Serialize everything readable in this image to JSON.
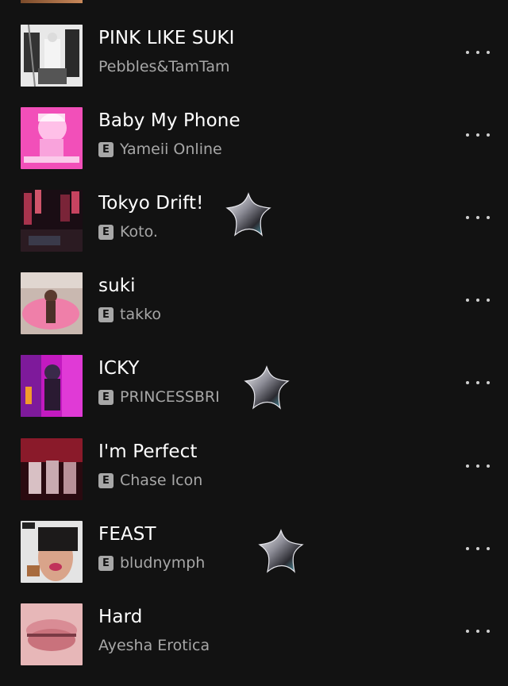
{
  "tracks": [
    {
      "title": "PINK LIKE SUKI",
      "artist": "Pebbles&TamTam",
      "explicit": false,
      "explicit_badge": "",
      "cover": "cover-art-pink-like-suki"
    },
    {
      "title": "Baby My Phone",
      "artist": "Yameii Online",
      "explicit": true,
      "explicit_badge": "E",
      "cover": "cover-art-baby-my-phone"
    },
    {
      "title": "Tokyo Drift!",
      "artist": "Koto.",
      "explicit": true,
      "explicit_badge": "E",
      "cover": "cover-art-tokyo-drift"
    },
    {
      "title": "suki",
      "artist": "takko",
      "explicit": true,
      "explicit_badge": "E",
      "cover": "cover-art-suki"
    },
    {
      "title": "ICKY",
      "artist": "PRINCESSBRI",
      "explicit": true,
      "explicit_badge": "E",
      "cover": "cover-art-icky"
    },
    {
      "title": "I'm Perfect",
      "artist": "Chase Icon",
      "explicit": true,
      "explicit_badge": "E",
      "cover": "cover-art-im-perfect"
    },
    {
      "title": "FEAST",
      "artist": "bludnymph",
      "explicit": true,
      "explicit_badge": "E",
      "cover": "cover-art-feast"
    },
    {
      "title": "Hard",
      "artist": "Ayesha Erotica",
      "explicit": false,
      "explicit_badge": "",
      "cover": "cover-art-hard"
    }
  ],
  "icons": {
    "more": "more-options-icon",
    "sticker": "chrome-star-sticker-icon"
  },
  "colors": {
    "background": "#121212",
    "title": "#ffffff",
    "subtitle": "#a7a7a7",
    "explicit_badge": "#a7a7a7"
  }
}
